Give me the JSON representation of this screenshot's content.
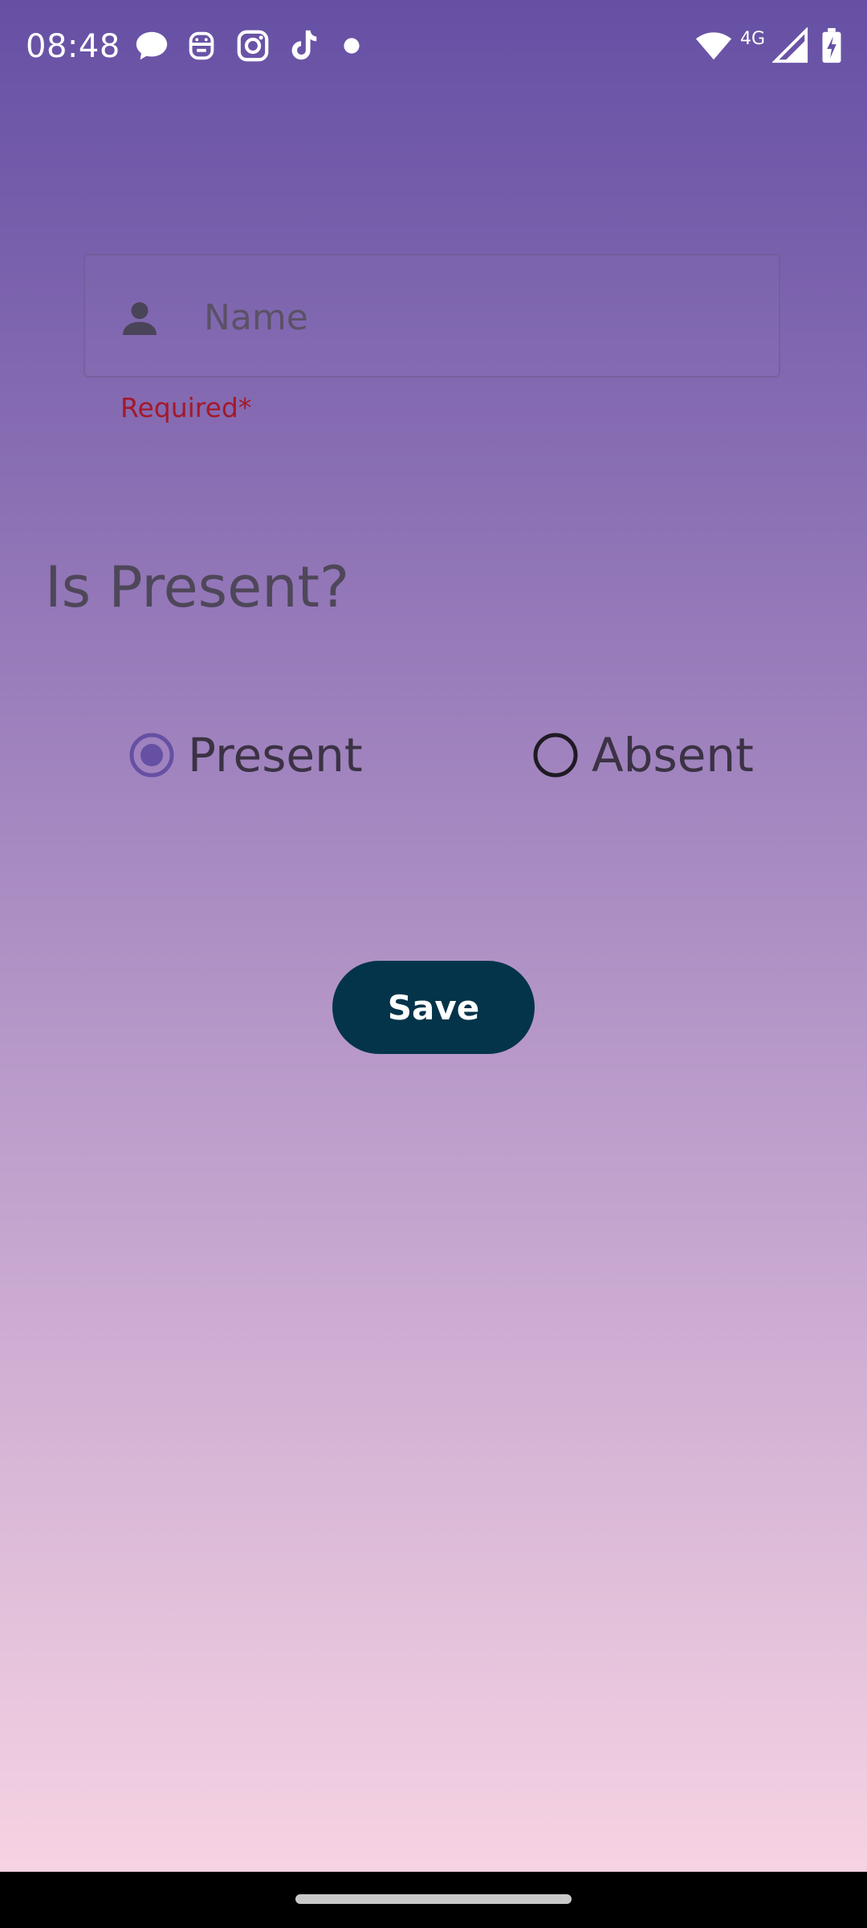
{
  "status_bar": {
    "time": "08:48",
    "network_type": "4G",
    "notification_icons": [
      "chat-bubble-icon",
      "robot-face-icon",
      "instagram-icon",
      "tiktok-icon",
      "more-dot-icon"
    ],
    "system_icons": [
      "wifi-icon",
      "cell-signal-icon",
      "battery-charging-icon"
    ]
  },
  "form": {
    "name_field": {
      "placeholder": "Name",
      "value": "",
      "icon": "person-icon",
      "error": "Required*"
    },
    "question": "Is Present?",
    "attendance": {
      "options": [
        {
          "label": "Present",
          "selected": true
        },
        {
          "label": "Absent",
          "selected": false
        }
      ]
    },
    "save_label": "Save"
  },
  "colors": {
    "gradient_top": "#6650a4",
    "gradient_bottom": "#fbd6e4",
    "error": "#a3192a",
    "button": "#03344a",
    "radio_selected": "#6650a4"
  }
}
